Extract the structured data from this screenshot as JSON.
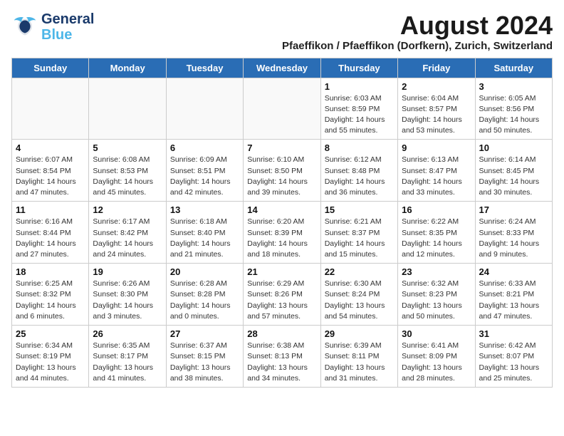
{
  "header": {
    "logo_general": "General",
    "logo_blue": "Blue",
    "title": "August 2024",
    "subtitle": "Pfaeffikon / Pfaeffikon (Dorfkern), Zurich, Switzerland"
  },
  "days_of_week": [
    "Sunday",
    "Monday",
    "Tuesday",
    "Wednesday",
    "Thursday",
    "Friday",
    "Saturday"
  ],
  "weeks": [
    [
      {
        "day": "",
        "info": ""
      },
      {
        "day": "",
        "info": ""
      },
      {
        "day": "",
        "info": ""
      },
      {
        "day": "",
        "info": ""
      },
      {
        "day": "1",
        "info": "Sunrise: 6:03 AM\nSunset: 8:59 PM\nDaylight: 14 hours and 55 minutes."
      },
      {
        "day": "2",
        "info": "Sunrise: 6:04 AM\nSunset: 8:57 PM\nDaylight: 14 hours and 53 minutes."
      },
      {
        "day": "3",
        "info": "Sunrise: 6:05 AM\nSunset: 8:56 PM\nDaylight: 14 hours and 50 minutes."
      }
    ],
    [
      {
        "day": "4",
        "info": "Sunrise: 6:07 AM\nSunset: 8:54 PM\nDaylight: 14 hours and 47 minutes."
      },
      {
        "day": "5",
        "info": "Sunrise: 6:08 AM\nSunset: 8:53 PM\nDaylight: 14 hours and 45 minutes."
      },
      {
        "day": "6",
        "info": "Sunrise: 6:09 AM\nSunset: 8:51 PM\nDaylight: 14 hours and 42 minutes."
      },
      {
        "day": "7",
        "info": "Sunrise: 6:10 AM\nSunset: 8:50 PM\nDaylight: 14 hours and 39 minutes."
      },
      {
        "day": "8",
        "info": "Sunrise: 6:12 AM\nSunset: 8:48 PM\nDaylight: 14 hours and 36 minutes."
      },
      {
        "day": "9",
        "info": "Sunrise: 6:13 AM\nSunset: 8:47 PM\nDaylight: 14 hours and 33 minutes."
      },
      {
        "day": "10",
        "info": "Sunrise: 6:14 AM\nSunset: 8:45 PM\nDaylight: 14 hours and 30 minutes."
      }
    ],
    [
      {
        "day": "11",
        "info": "Sunrise: 6:16 AM\nSunset: 8:44 PM\nDaylight: 14 hours and 27 minutes."
      },
      {
        "day": "12",
        "info": "Sunrise: 6:17 AM\nSunset: 8:42 PM\nDaylight: 14 hours and 24 minutes."
      },
      {
        "day": "13",
        "info": "Sunrise: 6:18 AM\nSunset: 8:40 PM\nDaylight: 14 hours and 21 minutes."
      },
      {
        "day": "14",
        "info": "Sunrise: 6:20 AM\nSunset: 8:39 PM\nDaylight: 14 hours and 18 minutes."
      },
      {
        "day": "15",
        "info": "Sunrise: 6:21 AM\nSunset: 8:37 PM\nDaylight: 14 hours and 15 minutes."
      },
      {
        "day": "16",
        "info": "Sunrise: 6:22 AM\nSunset: 8:35 PM\nDaylight: 14 hours and 12 minutes."
      },
      {
        "day": "17",
        "info": "Sunrise: 6:24 AM\nSunset: 8:33 PM\nDaylight: 14 hours and 9 minutes."
      }
    ],
    [
      {
        "day": "18",
        "info": "Sunrise: 6:25 AM\nSunset: 8:32 PM\nDaylight: 14 hours and 6 minutes."
      },
      {
        "day": "19",
        "info": "Sunrise: 6:26 AM\nSunset: 8:30 PM\nDaylight: 14 hours and 3 minutes."
      },
      {
        "day": "20",
        "info": "Sunrise: 6:28 AM\nSunset: 8:28 PM\nDaylight: 14 hours and 0 minutes."
      },
      {
        "day": "21",
        "info": "Sunrise: 6:29 AM\nSunset: 8:26 PM\nDaylight: 13 hours and 57 minutes."
      },
      {
        "day": "22",
        "info": "Sunrise: 6:30 AM\nSunset: 8:24 PM\nDaylight: 13 hours and 54 minutes."
      },
      {
        "day": "23",
        "info": "Sunrise: 6:32 AM\nSunset: 8:23 PM\nDaylight: 13 hours and 50 minutes."
      },
      {
        "day": "24",
        "info": "Sunrise: 6:33 AM\nSunset: 8:21 PM\nDaylight: 13 hours and 47 minutes."
      }
    ],
    [
      {
        "day": "25",
        "info": "Sunrise: 6:34 AM\nSunset: 8:19 PM\nDaylight: 13 hours and 44 minutes."
      },
      {
        "day": "26",
        "info": "Sunrise: 6:35 AM\nSunset: 8:17 PM\nDaylight: 13 hours and 41 minutes."
      },
      {
        "day": "27",
        "info": "Sunrise: 6:37 AM\nSunset: 8:15 PM\nDaylight: 13 hours and 38 minutes."
      },
      {
        "day": "28",
        "info": "Sunrise: 6:38 AM\nSunset: 8:13 PM\nDaylight: 13 hours and 34 minutes."
      },
      {
        "day": "29",
        "info": "Sunrise: 6:39 AM\nSunset: 8:11 PM\nDaylight: 13 hours and 31 minutes."
      },
      {
        "day": "30",
        "info": "Sunrise: 6:41 AM\nSunset: 8:09 PM\nDaylight: 13 hours and 28 minutes."
      },
      {
        "day": "31",
        "info": "Sunrise: 6:42 AM\nSunset: 8:07 PM\nDaylight: 13 hours and 25 minutes."
      }
    ]
  ]
}
